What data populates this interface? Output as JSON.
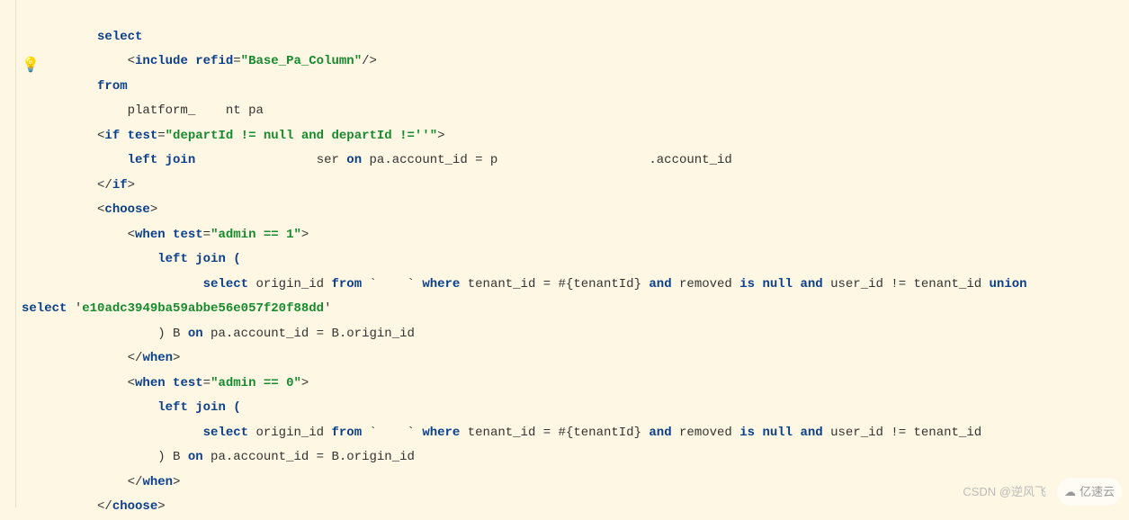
{
  "code": {
    "select_kw": "select",
    "include_open": "<",
    "include_tag": "include",
    "include_sp": " ",
    "refid_attr": "refid",
    "eq": "=",
    "refid_val": "\"Base_Pa_Column\"",
    "include_close": "/>",
    "from_kw": "from",
    "table_pre": "platform_",
    "table_blur": "    ",
    "table_suf": "nt pa",
    "if_lt": "<",
    "if_tag": "if",
    "test_attr": "test",
    "test_val1": "\"departId != null and departId !=''\"",
    "gt": ">",
    "leftjoin_kw1": "left join",
    "join1_mid": " ",
    "join1_blur": "               ",
    "join1_ser": "ser ",
    "on_kw": "on",
    "join1_on": " pa.account_id = p",
    "join1_blur2": "                    ",
    "join1_tail": ".account_id",
    "if_close": "</",
    "if_close_tag": "if",
    "choose_tag": "choose",
    "when_tag": "when",
    "test_admin1": "\"admin == 1\"",
    "leftjoin_paren": "left join (",
    "select_kw2": "select",
    "origin_from": " origin_id ",
    "from_kw2": "from",
    "tick_open": " `",
    "tick_blur": "    ",
    "tick_close": "` ",
    "where_kw": "where",
    "where_body1": " tenant_id = #{tenantId} ",
    "and_kw": "and",
    "removed": " removed ",
    "is_kw": "is",
    "null_kw": "null",
    "userneq": " user_id != tenant_id ",
    "union_kw": "union",
    "sel_str": " '",
    "md5_val": "e10adc3949ba59abbe56e057f20f88dd",
    "sel_str_end": "'",
    "paren_B": ") B ",
    "on_B": " pa.account_id = B.origin_id",
    "test_admin0": "\"admin == 0\"",
    "select_prefix2": "select"
  },
  "gutter": {
    "bulb": "💡"
  },
  "watermark": {
    "csdn": "CSDN @逆风飞",
    "yisu": "亿速云"
  }
}
